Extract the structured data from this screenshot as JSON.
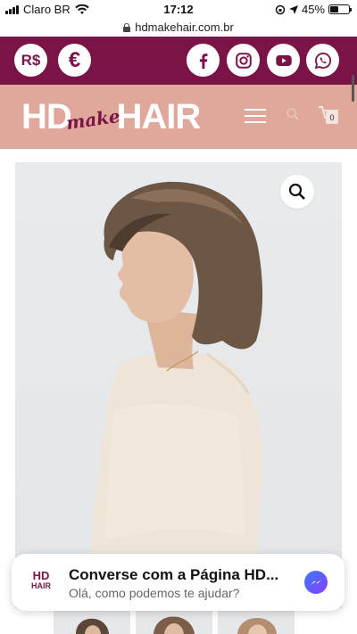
{
  "status_bar": {
    "carrier": "Claro BR",
    "time": "17:12",
    "battery": "45%",
    "battery_level": 0.45
  },
  "url_bar": {
    "url": "hdmakehair.com.br"
  },
  "topbar": {
    "currency_buttons": [
      {
        "label": "R$",
        "icon": "real-currency-icon"
      },
      {
        "label": "€",
        "icon": "euro-currency-icon"
      }
    ],
    "social_icons": [
      "facebook-icon",
      "instagram-icon",
      "youtube-icon",
      "whatsapp-icon"
    ]
  },
  "header": {
    "logo": {
      "part1": "HD",
      "part2": "make",
      "part3": "HAIR"
    },
    "cart_count": "0"
  },
  "chat": {
    "logo_line1": "HD",
    "logo_line2": "HAIR",
    "title": "Converse com a Página HD...",
    "subtitle": "Olá, como podemos te ajudar?"
  },
  "colors": {
    "maroon": "#7a1447",
    "header_pink": "#dfa89b",
    "image_bg": "#e6e9ec"
  }
}
